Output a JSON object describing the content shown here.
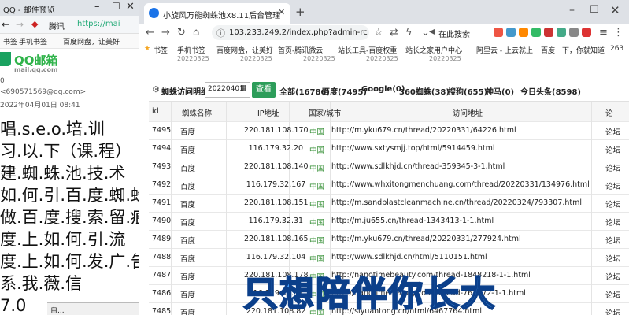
{
  "left_window": {
    "title": "QQ - 邮件预览",
    "nav": {
      "back": "←",
      "forward": "→",
      "brand": "腾讯",
      "url": "https://mai"
    },
    "bookmarks": [
      "书签",
      "手机书签",
      "百度网盘，让美好"
    ],
    "logo": {
      "name": "QQ邮箱",
      "domain": "mail.qq.com"
    },
    "meta": {
      "line1": "0",
      "sender": "<690571569@qq.com>",
      "date": "2022年04月01日 08:41"
    },
    "body_lines": [
      "唱.s.e.o.培.训",
      "习.以.下（课.程）",
      "建.蜘.蛛.池.技.术",
      "如.何.引.百.度.蜘.蛛)",
      "做.百.度.搜.索.留.痕",
      "度.上.如.何.引.流",
      "度.上.如.何.发.广.告",
      "系.我.薇.信",
      "7.0"
    ],
    "taskbar_label": "自..."
  },
  "browser": {
    "tab_title": "小旋风万能蜘蛛池X8.11后台管理",
    "new_tab": "+",
    "url": "103.233.249.2/index.php?admin-rc",
    "prev_search": "在此搜索",
    "bookmarks": [
      "书签",
      "手机书签",
      "百度网盘，让美好",
      "首页-腾讯微云",
      "站长工具-百度权重",
      "站长之家用户中心",
      "阿里云 - 上云就上",
      "百度一下，你就知道",
      "263"
    ],
    "stale_dates": [
      "20220325",
      "20220325",
      "20220325",
      "20220325",
      "20220325"
    ],
    "colors": {
      "accent": "#2d9d5a",
      "caption_fill": "#4aa3ff",
      "country_green": "#2e8b2e"
    }
  },
  "filter": {
    "label": "蜘蛛访问明细",
    "date_value": "20220401",
    "query_button": "查看",
    "stats": [
      "全部(16786)",
      "百度(7495)",
      "Google(0)",
      "360蜘蛛(38)",
      "搜狗(655)",
      "神马(0)",
      "今日头条(8598)"
    ]
  },
  "table": {
    "headers": [
      "id",
      "蜘蛛名称",
      "IP地址",
      "国家/城市",
      "访问地址",
      "论"
    ],
    "rows": [
      {
        "id": "7495",
        "spider": "百度",
        "ip": "220.181.108.170",
        "country": "中国",
        "url": "http://m.yku679.cn/thread/20220331/64226.html",
        "extra": "论坛"
      },
      {
        "id": "7494",
        "spider": "百度",
        "ip": "116.179.32.20",
        "country": "中国",
        "url": "http://www.sxtysmjj.top/html/5914459.html",
        "extra": "论坛"
      },
      {
        "id": "7493",
        "spider": "百度",
        "ip": "220.181.108.140",
        "country": "中国",
        "url": "http://www.sdlkhjd.cn/thread-359345-3-1.html",
        "extra": "论坛"
      },
      {
        "id": "7492",
        "spider": "百度",
        "ip": "116.179.32.167",
        "country": "中国",
        "url": "http://www.whxitongmenchuang.com/thread/20220331/134976.html",
        "extra": "论坛"
      },
      {
        "id": "7491",
        "spider": "百度",
        "ip": "220.181.108.151",
        "country": "中国",
        "url": "http://m.sandblastcleanmachine.cn/thread/20220324/793307.html",
        "extra": "论坛"
      },
      {
        "id": "7490",
        "spider": "百度",
        "ip": "116.179.32.31",
        "country": "中国",
        "url": "http://m.ju655.cn/thread-1343413-1-1.html",
        "extra": "论坛"
      },
      {
        "id": "7489",
        "spider": "百度",
        "ip": "220.181.108.165",
        "country": "中国",
        "url": "http://m.yku679.cn/thread/20220331/277924.html",
        "extra": "论坛"
      },
      {
        "id": "7488",
        "spider": "百度",
        "ip": "116.179.32.104",
        "country": "中国",
        "url": "http://www.sdlkhjd.cn/html/5110151.html",
        "extra": "论坛"
      },
      {
        "id": "7487",
        "spider": "百度",
        "ip": "220.181.108.178",
        "country": "中国",
        "url": "http://nanotimebeauty.com/thread-1848218-1-1.html",
        "extra": "论坛"
      },
      {
        "id": "7486",
        "spider": "百度",
        "ip": "116.179.32.97",
        "country": "中国",
        "url": "http://nanotimebeauty.com/thread-767372-1-1.html",
        "extra": "论坛"
      },
      {
        "id": "7485",
        "spider": "百度",
        "ip": "220.181.108.82",
        "country": "中国",
        "url": "http://siyuantong.cn/html/6467764.html",
        "extra": "论坛"
      }
    ]
  },
  "caption": "只想陪伴你长大"
}
